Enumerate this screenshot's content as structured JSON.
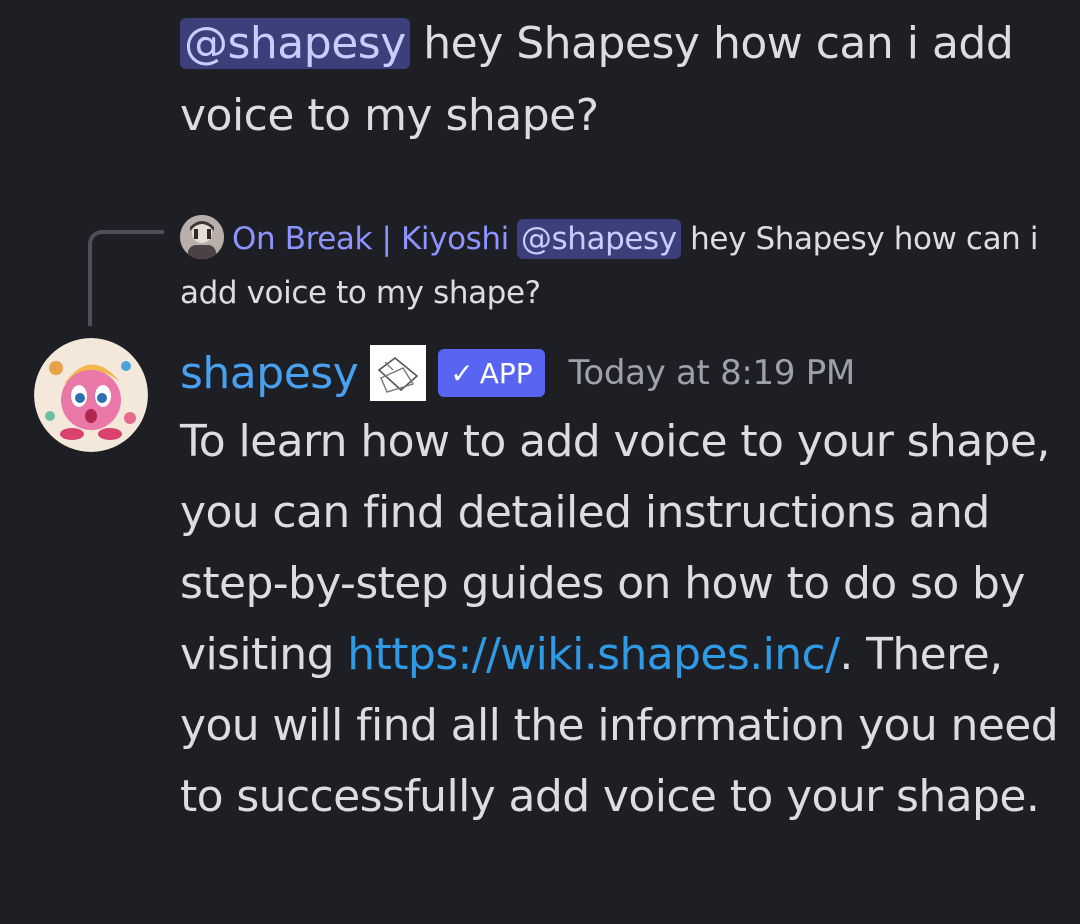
{
  "previous_message": {
    "mention": "@shapesy",
    "text": " hey Shapesy how can i add voice to my shape?"
  },
  "reply_preview": {
    "author": "On Break | Kiyoshi",
    "mention": "@shapesy",
    "text": " hey Shapesy how can i add voice to my shape?"
  },
  "message": {
    "author": "shapesy",
    "badge": "APP",
    "timestamp": "Today at 8:19 PM",
    "text_before_link": "To learn how to add voice to your shape, you can find detailed instructions and step-by-step guides on how to do so by visiting ",
    "link": "https://wiki.shapes.inc/",
    "text_after_link": ". There, you will find all the information you need to successfully add voice to your shape."
  },
  "colors": {
    "background": "#1e1f24",
    "mention_bg": "#3c3f7a",
    "username": "#48a0f0",
    "reply_author": "#8d94ff",
    "app_badge": "#5865f2",
    "link": "#2f9be6"
  }
}
